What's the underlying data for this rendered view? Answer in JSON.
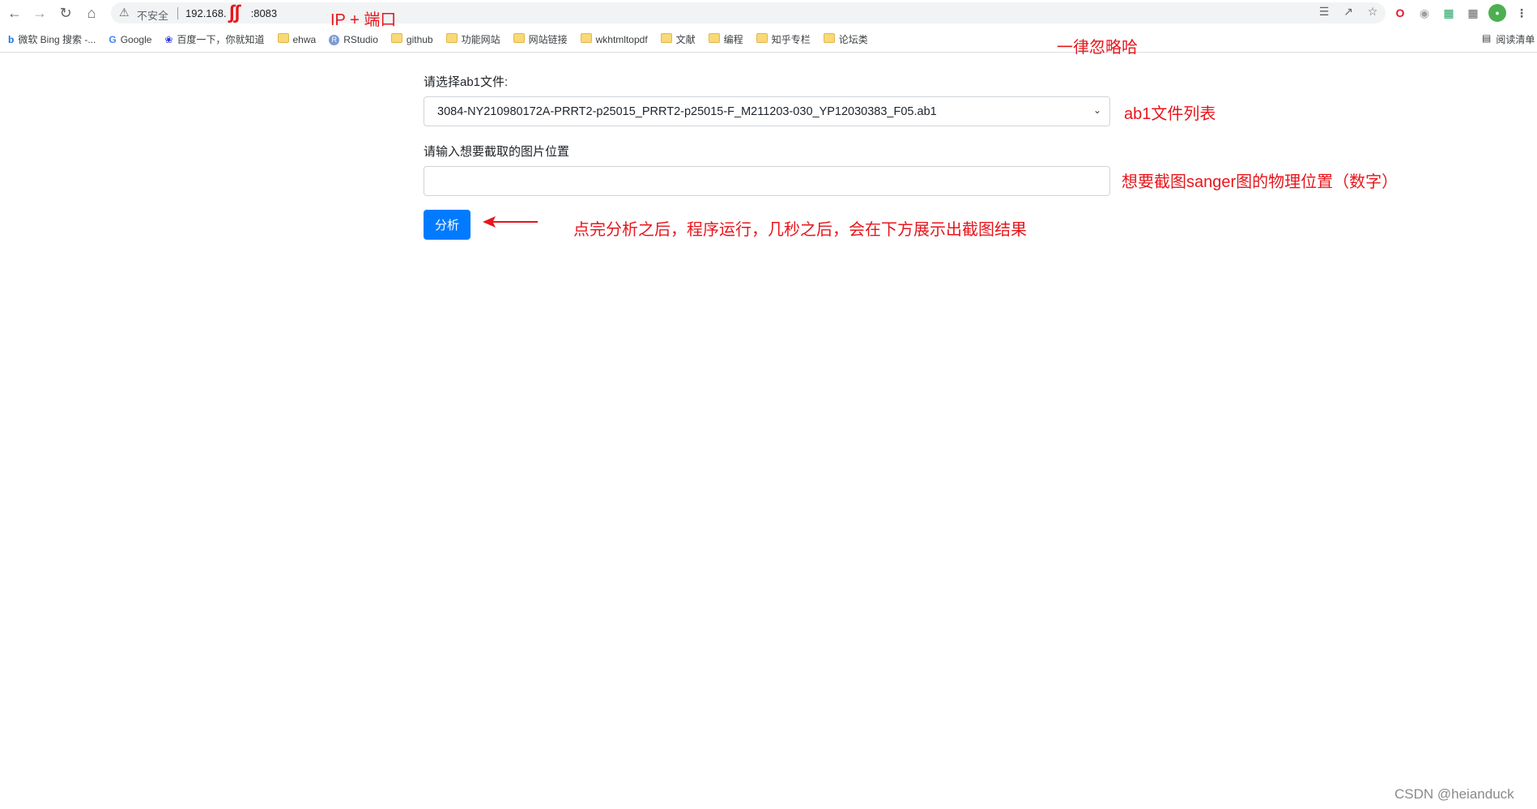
{
  "browser": {
    "security_label": "不安全",
    "url": "192.168.",
    "url_suffix": ":8083"
  },
  "bookmarks": [
    {
      "icon": "bing-icon",
      "label": "微软 Bing 搜索 -..."
    },
    {
      "icon": "google-icon",
      "label": "Google"
    },
    {
      "icon": "baidu-icon",
      "label": "百度一下，你就知道"
    },
    {
      "icon": "folder-icon",
      "label": "ehwa"
    },
    {
      "icon": "rstudio-icon",
      "label": "RStudio"
    },
    {
      "icon": "folder-icon",
      "label": "github"
    },
    {
      "icon": "folder-icon",
      "label": "功能网站"
    },
    {
      "icon": "folder-icon",
      "label": "网站链接"
    },
    {
      "icon": "folder-icon",
      "label": "wkhtmltopdf"
    },
    {
      "icon": "folder-icon",
      "label": "文献"
    },
    {
      "icon": "folder-icon",
      "label": "编程"
    },
    {
      "icon": "folder-icon",
      "label": "知乎专栏"
    },
    {
      "icon": "folder-icon",
      "label": "论坛类"
    }
  ],
  "reading_list": "阅读清单",
  "form": {
    "file_label": "请选择ab1文件:",
    "file_selected": "3084-NY210980172A-PRRT2-p25015_PRRT2-p25015-F_M211203-030_YP12030383_F05.ab1",
    "position_label": "请输入想要截取的图片位置",
    "position_value": "",
    "analyze_button": "分析"
  },
  "annotations": {
    "ip_port": "IP + 端口",
    "ignore": "一律忽略哈",
    "file_list": "ab1文件列表",
    "position": "想要截图sanger图的物理位置（数字）",
    "result": "点完分析之后，程序运行，几秒之后，会在下方展示出截图结果"
  },
  "watermark": "CSDN @heianduck",
  "colors": {
    "annotation": "#e8151b",
    "button": "#007bff"
  }
}
